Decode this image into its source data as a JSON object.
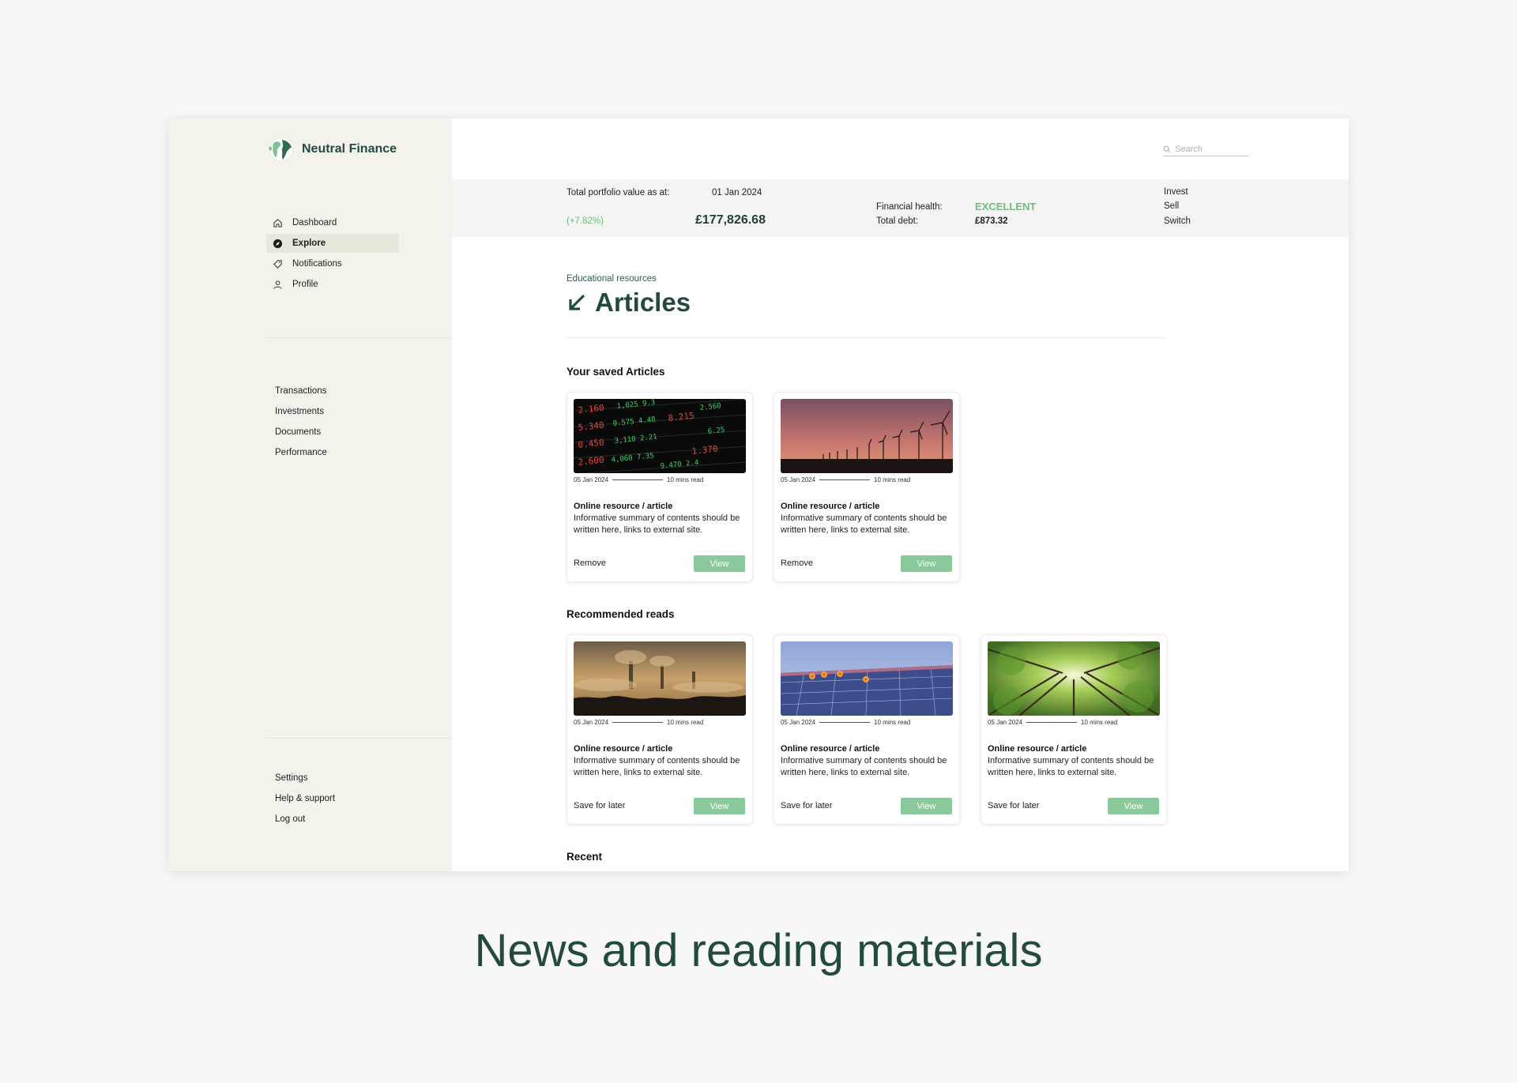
{
  "brand": {
    "name": "Neutral Finance"
  },
  "search": {
    "placeholder": "Search"
  },
  "sidebar": {
    "nav": [
      {
        "label": "Dashboard",
        "icon": "home-icon"
      },
      {
        "label": "Explore",
        "icon": "compass-icon",
        "active": true
      },
      {
        "label": "Notifications",
        "icon": "tag-icon"
      },
      {
        "label": "Profile",
        "icon": "user-icon"
      }
    ],
    "links": [
      "Transactions",
      "Investments",
      "Documents",
      "Performance"
    ],
    "bottom": [
      "Settings",
      "Help & support",
      "Log out"
    ]
  },
  "stats": {
    "portfolio_label": "Total portfolio value as at:",
    "date": "01 Jan 2024",
    "change": "(+7.82%)",
    "value": "£177,826.68",
    "health_label": "Financial health:",
    "health_value": "EXCELLENT",
    "debt_label": "Total debt:",
    "debt_value": "£873.32",
    "actions": [
      "Invest",
      "Sell",
      "Switch"
    ]
  },
  "page": {
    "subtitle": "Educational resources",
    "title": "Articles"
  },
  "sections": {
    "saved": "Your saved Articles",
    "recommended": "Recommended reads",
    "recent": "Recent"
  },
  "saved_cards": [
    {
      "image": "stock-ticker-image",
      "date": "05 Jan 2024",
      "read_time": "10 mins read",
      "title": "Online resource / article",
      "summary": "Informative summary of contents should be written here, links to external site.",
      "action": "Remove",
      "button": "View"
    },
    {
      "image": "wind-turbines-image",
      "date": "05 Jan 2024",
      "read_time": "10 mins read",
      "title": "Online resource / article",
      "summary": "Informative summary of contents should be written here, links to external site.",
      "action": "Remove",
      "button": "View"
    }
  ],
  "recommended_cards": [
    {
      "image": "smoggy-city-image",
      "date": "05 Jan 2024",
      "read_time": "10 mins read",
      "title": "Online resource / article",
      "summary": "Informative summary of contents should be written here, links to external site.",
      "action": "Save for later",
      "button": "View"
    },
    {
      "image": "solar-panels-image",
      "date": "05 Jan 2024",
      "read_time": "10 mins read",
      "title": "Online resource / article",
      "summary": "Informative summary of contents should be written here, links to external site.",
      "action": "Save for later",
      "button": "View"
    },
    {
      "image": "forest-canopy-image",
      "date": "05 Jan 2024",
      "read_time": "10 mins read",
      "title": "Online resource / article",
      "summary": "Informative summary of contents should be written here, links to external site.",
      "action": "Save for later",
      "button": "View"
    }
  ],
  "caption": "News and reading materials",
  "colors": {
    "brand": "#234a3f",
    "accent": "#8ac99b",
    "positive": "#6cbf82",
    "sidebar_bg": "#f3f3ec"
  }
}
